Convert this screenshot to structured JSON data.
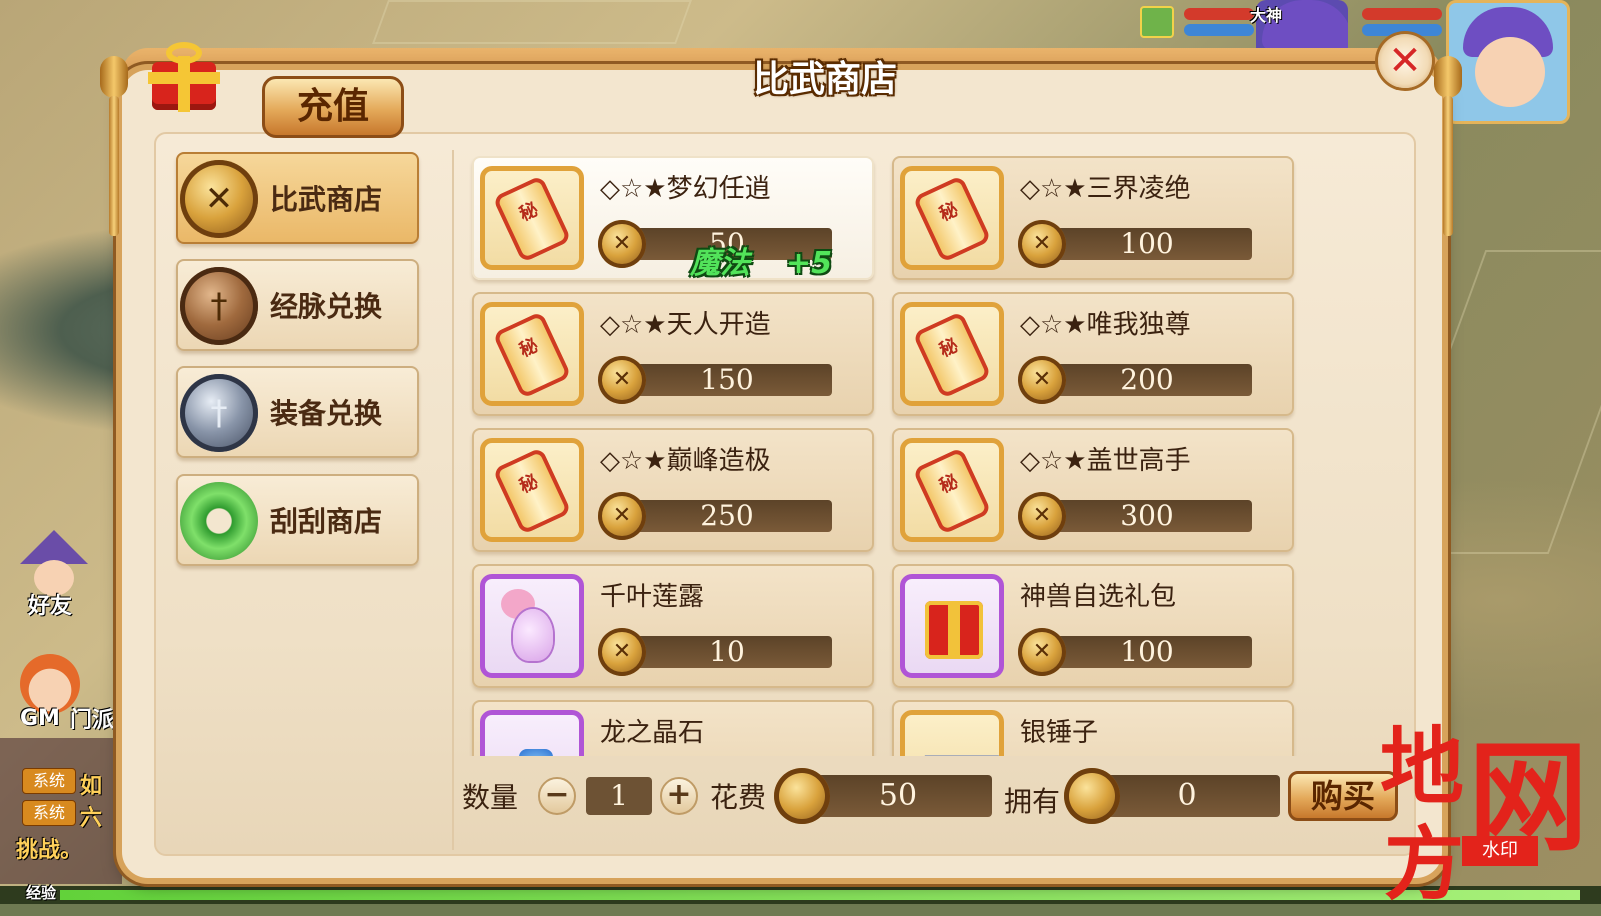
{
  "shop": {
    "title": "比武商店",
    "recharge_label": "充值",
    "close_label": "✕"
  },
  "sidebar": {
    "items": [
      {
        "label": "比武商店",
        "icon": "crossed-swords-gold-coin-icon",
        "active": true
      },
      {
        "label": "经脉兑换",
        "icon": "bronze-sword-coin-icon",
        "active": false
      },
      {
        "label": "装备兑换",
        "icon": "silver-sword-coin-icon",
        "active": false
      },
      {
        "label": "刮刮商店",
        "icon": "jade-disc-icon",
        "active": false
      }
    ]
  },
  "items": [
    {
      "name": "◇☆★梦幻任逍",
      "price": "50",
      "icon": "gold-scroll-icon",
      "selected": true
    },
    {
      "name": "◇☆★三界凌绝",
      "price": "100",
      "icon": "gold-scroll-icon",
      "selected": false
    },
    {
      "name": "◇☆★天人开造",
      "price": "150",
      "icon": "gold-scroll-icon",
      "selected": false
    },
    {
      "name": "◇☆★唯我独尊",
      "price": "200",
      "icon": "gold-scroll-icon",
      "selected": false
    },
    {
      "name": "◇☆★巅峰造极",
      "price": "250",
      "icon": "gold-scroll-icon",
      "selected": false
    },
    {
      "name": "◇☆★盖世高手",
      "price": "300",
      "icon": "gold-scroll-icon",
      "selected": false
    },
    {
      "name": "千叶莲露",
      "price": "10",
      "icon": "lotus-vase-icon",
      "selected": false
    },
    {
      "name": "神兽自选礼包",
      "price": "100",
      "icon": "gift-box-icon",
      "selected": false
    },
    {
      "name": "龙之晶石",
      "price": "",
      "icon": "dragon-crystal-icon",
      "selected": false
    },
    {
      "name": "银锤子",
      "price": "",
      "icon": "silver-ingot-icon",
      "selected": false
    }
  ],
  "floating_text": {
    "stat": "魔法",
    "value": "+5"
  },
  "purchase": {
    "quantity_label": "数量",
    "minus": "−",
    "plus": "+",
    "quantity": "1",
    "cost_label": "花费",
    "cost": "50",
    "owned_label": "拥有",
    "owned": "0",
    "buy_label": "购买"
  },
  "hud": {
    "friends_label": "好友",
    "gm_label": "GM",
    "faction_label": "门派",
    "chat_lines": [
      {
        "badge": "系统",
        "text": "如"
      },
      {
        "badge": "系统",
        "text": "六"
      }
    ],
    "chat_tail": "挑战。",
    "exp_label": "经验",
    "player_name_tag": "大神"
  },
  "watermark": {
    "chars": [
      "地",
      "方",
      "网"
    ],
    "tag": "水印"
  },
  "colors": {
    "accent": "#d7a35b",
    "price_bar": "#6d5234",
    "float_text": "#52e35a",
    "watermark": "#e3231b"
  }
}
